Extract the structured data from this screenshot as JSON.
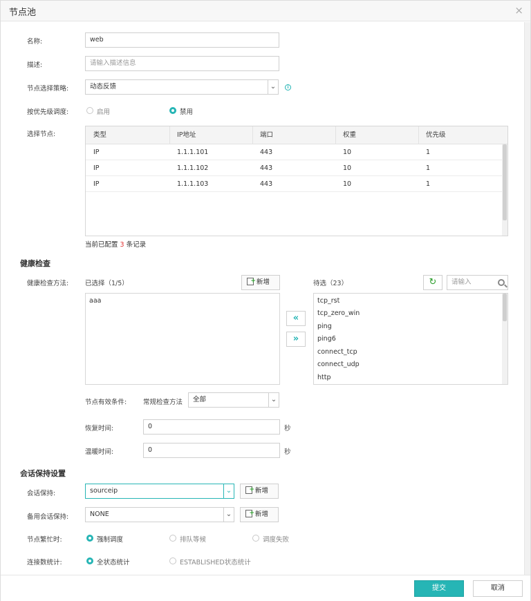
{
  "dialog": {
    "title": "节点池",
    "close_glyph": "×"
  },
  "form": {
    "name_label": "名称:",
    "name_value": "web",
    "desc_label": "描述:",
    "desc_placeholder": "请输入描述信息",
    "strategy_label": "节点选择策略:",
    "strategy_value": "动态反馈",
    "priority_label": "按优先级调度:",
    "priority_options": [
      "启用",
      "禁用"
    ],
    "priority_selected": "禁用",
    "nodes_label": "选择节点:"
  },
  "nodes_table": {
    "columns": [
      "类型",
      "IP地址",
      "端口",
      "权重",
      "优先级"
    ],
    "rows": [
      [
        "IP",
        "1.1.1.101",
        "443",
        "10",
        "1"
      ],
      [
        "IP",
        "1.1.1.102",
        "443",
        "10",
        "1"
      ],
      [
        "IP",
        "1.1.1.103",
        "443",
        "10",
        "1"
      ]
    ],
    "count_prefix": "当前已配置",
    "count_value": "3",
    "count_suffix": "条记录"
  },
  "health": {
    "section_title": "健康检查",
    "method_label": "健康检查方法:",
    "selected_title": "已选择（1/5）",
    "add_label": "新增",
    "selected_items": [
      "aaa"
    ],
    "available_title": "待选（23）",
    "search_placeholder": "请输入",
    "available_items": [
      "tcp_rst",
      "tcp_zero_win",
      "ping",
      "ping6",
      "connect_tcp",
      "connect_udp",
      "http"
    ],
    "move_left": "«",
    "move_right": "»",
    "refresh_glyph": "↻",
    "condition_label": "节点有效条件:",
    "condition_sub_label": "常规检查方法",
    "condition_value": "全部",
    "recover_label": "恢复时间:",
    "recover_value": "0",
    "warmup_label": "温暖时间:",
    "warmup_value": "0",
    "unit_seconds": "秒"
  },
  "session": {
    "section_title": "会话保持设置",
    "persist_label": "会话保持:",
    "persist_value": "sourceip",
    "backup_label": "备用会话保持:",
    "backup_value": "NONE",
    "add_label": "新增",
    "busy_label": "节点繁忙时:",
    "busy_options": [
      "强制调度",
      "排队等候",
      "调度失败"
    ],
    "busy_selected": "强制调度",
    "stats_label": "连接数统计:",
    "stats_options": [
      "全状态统计",
      "ESTABLISHED状态统计"
    ],
    "stats_selected": "全状态统计"
  },
  "footer": {
    "submit_label": "提交",
    "cancel_label": "取消"
  },
  "colors": {
    "accent": "#26b5b5",
    "danger": "#e23333"
  }
}
